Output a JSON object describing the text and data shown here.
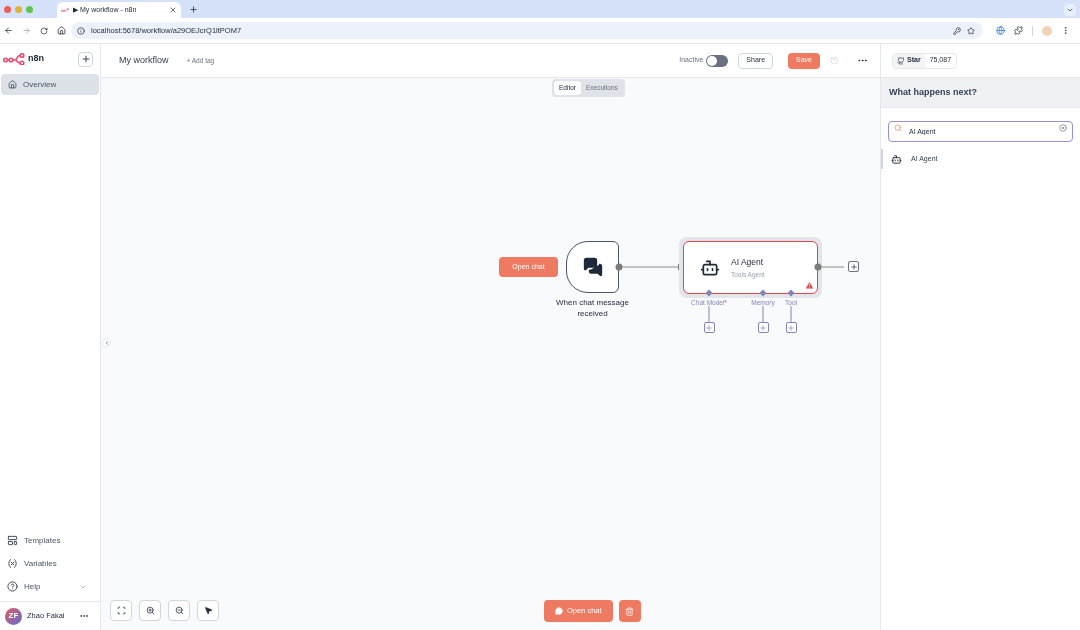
{
  "browser": {
    "tab_title": "▶ My workflow - n8n",
    "url": "localhost:5678/workflow/a29OEJcrQ1ltPOM7"
  },
  "sidebar": {
    "brand": "n8n",
    "items": [
      {
        "label": "Overview",
        "selected": true
      }
    ],
    "bottom_items": [
      {
        "label": "Templates",
        "kind": "templates"
      },
      {
        "label": "Variables",
        "kind": "variables"
      },
      {
        "label": "Help",
        "kind": "help"
      }
    ],
    "user": {
      "initials": "ZF",
      "name": "Zhao Fakai"
    }
  },
  "header": {
    "title": "My workflow",
    "add_tag": "+ Add tag",
    "status_label": "Inactive",
    "active": false,
    "share": "Share",
    "save": "Save"
  },
  "github": {
    "label": "Star",
    "count": "75,087"
  },
  "view_tabs": [
    {
      "label": "Editor",
      "selected": true
    },
    {
      "label": "Executions",
      "selected": false
    }
  ],
  "canvas": {
    "trigger": {
      "button": "Open chat",
      "label": "When chat message received"
    },
    "agent": {
      "title": "AI Agent",
      "subtitle": "Tools Agent",
      "warning": true
    },
    "inputs": [
      {
        "label": "Chat Model",
        "required_mark": "*"
      },
      {
        "label": "Memory"
      },
      {
        "label": "Tool"
      }
    ]
  },
  "bottom_bar": {
    "open_chat": "Open chat"
  },
  "panel": {
    "title": "What happens next?",
    "search": {
      "value": "AI Agent"
    },
    "results": [
      {
        "label": "AI Agent"
      }
    ]
  }
}
